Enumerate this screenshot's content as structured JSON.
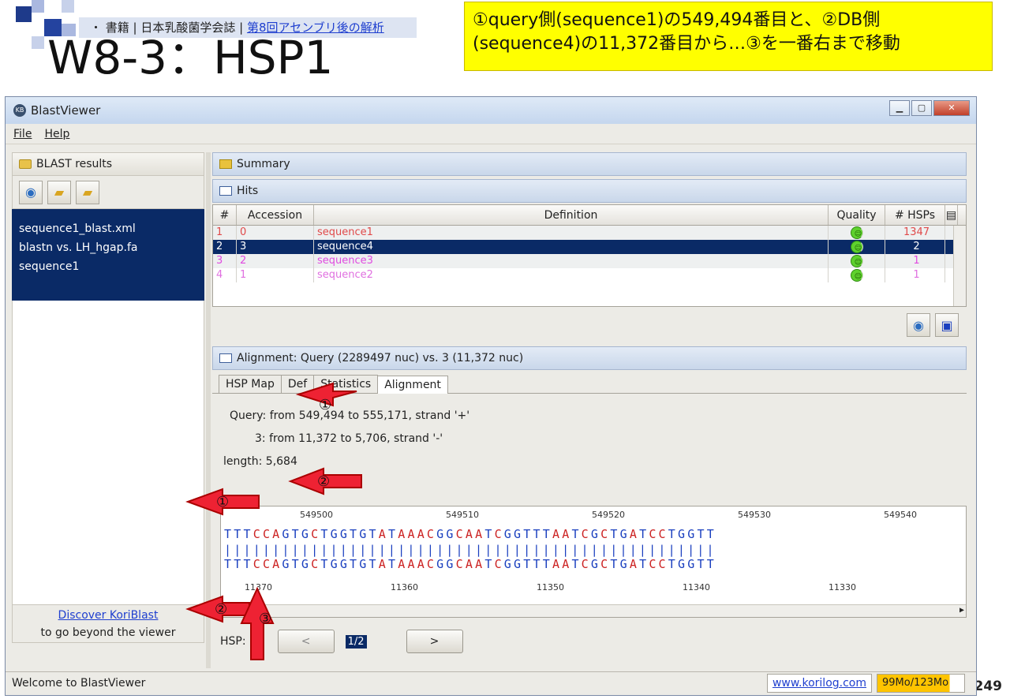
{
  "slide": {
    "crumb_prefix": "・ 書籍 | 日本乳酸菌学会誌 | ",
    "crumb_link": "第8回アセンブリ後の解析",
    "title": "W8-3：HSP1",
    "callout_line1": "①query側(sequence1)の549,494番目と、②DB側",
    "callout_line2": "(sequence4)の11,372番目から…③を一番右まで移動",
    "page_number": "249"
  },
  "window": {
    "title": "BlastViewer",
    "menu": [
      "File",
      "Help"
    ]
  },
  "left": {
    "header": "BLAST results",
    "items": [
      "sequence1_blast.xml",
      "blastn vs. LH_hgap.fa",
      "sequence1"
    ],
    "discover_link": "Discover KoriBlast",
    "discover_text": "to go beyond the viewer"
  },
  "summary": {
    "label": "Summary"
  },
  "hits": {
    "label": "Hits",
    "columns": [
      "#",
      "Accession",
      "Definition",
      "Quality",
      "# HSPs"
    ],
    "rows": [
      {
        "num": "1",
        "acc": "0",
        "def": "sequence1",
        "hsps": "1347"
      },
      {
        "num": "2",
        "acc": "3",
        "def": "sequence4",
        "hsps": "2"
      },
      {
        "num": "3",
        "acc": "2",
        "def": "sequence3",
        "hsps": "1"
      },
      {
        "num": "4",
        "acc": "1",
        "def": "sequence2",
        "hsps": "1"
      }
    ]
  },
  "alignment": {
    "header": "Alignment: Query (2289497 nuc) vs. 3 (11,372 nuc)",
    "tabs": [
      "HSP Map",
      "Def",
      "Statistics",
      "Alignment"
    ],
    "query": "Query: from 549,494 to 555,171, strand '+'",
    "subject": "3: from 11,372 to 5,706, strand '-'",
    "length": "length: 5,684",
    "ruler_top": [
      "549500",
      "549510",
      "549520",
      "549530",
      "549540"
    ],
    "ruler_bottom": [
      "11370",
      "11360",
      "11350",
      "11340",
      "11330"
    ],
    "seq_query": "TTTCCAGTGCTGGTGTATAAACGGCAATCGGTTTAATCGCTGATCCTGGTT",
    "seq_subject": "TTTCCAGTGCTGGTGTATAAACGGCAATCGGTTTAATCGCTGATCCTGGTT"
  },
  "hsp": {
    "label": "HSP:",
    "prev": "<",
    "counter": "1/2",
    "next": ">"
  },
  "status": {
    "text": "Welcome to BlastViewer",
    "link": "www.korilog.com",
    "memory": "99Mo/123Mo"
  },
  "annotations": [
    "①",
    "②",
    "①",
    "②",
    "③"
  ],
  "colors": {
    "selection": "#0a2a66",
    "callout": "#ffff00",
    "A": "#cc2222",
    "C": "#cc2222",
    "G": "#1a3fbf",
    "T": "#1a3fbf"
  }
}
